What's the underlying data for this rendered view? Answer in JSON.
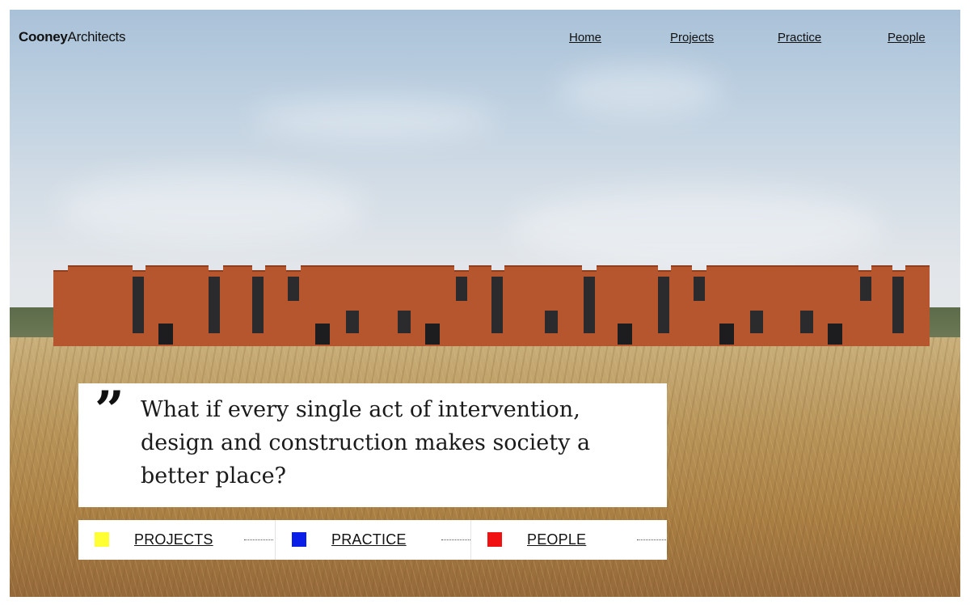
{
  "brand": {
    "name_bold": "Cooney",
    "name_regular": "Architects"
  },
  "nav": {
    "items": [
      "Home",
      "Projects",
      "Practice",
      "People"
    ]
  },
  "hero": {
    "image": "photo of long terracotta-clad building in a wheat field",
    "quote_mark": "”",
    "quote": "What if every single act of intervention, design and construction makes society a better place?"
  },
  "links": [
    {
      "label": "PROJECTS",
      "color": "#ffff33"
    },
    {
      "label": "PRACTICE",
      "color": "#0a1ee8"
    },
    {
      "label": "PEOPLE",
      "color": "#f01212"
    }
  ]
}
